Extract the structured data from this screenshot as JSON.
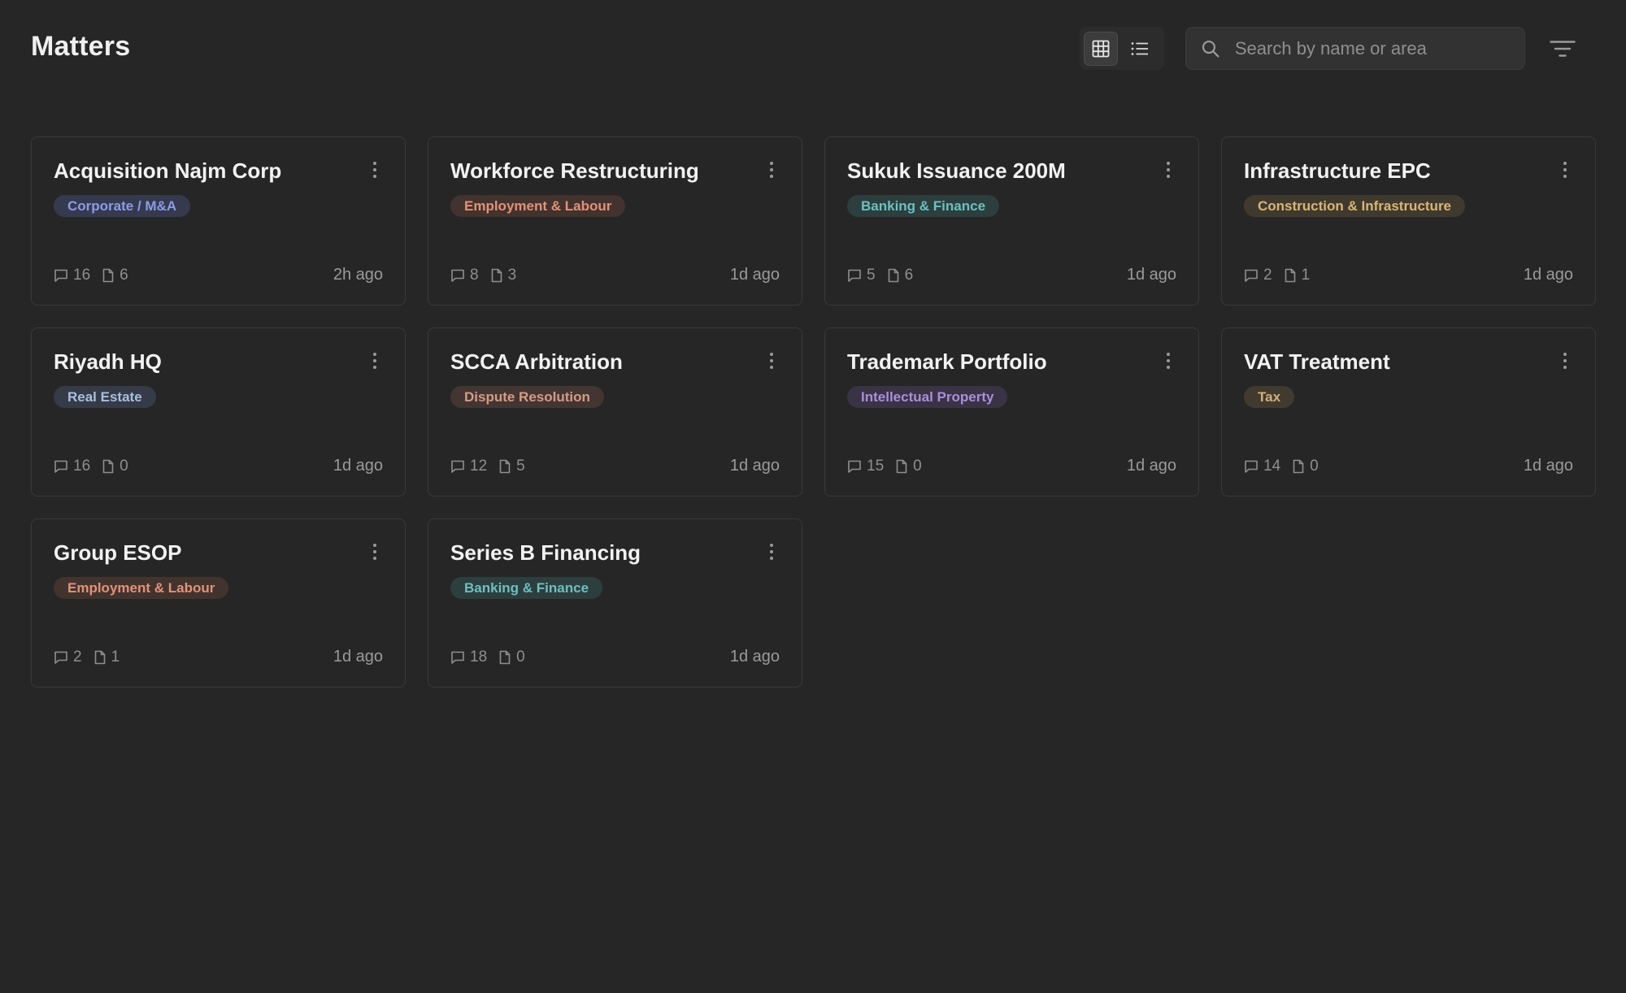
{
  "header": {
    "title": "Matters",
    "search_placeholder": "Search by name or area",
    "search_value": "",
    "view_modes": [
      {
        "name": "grid",
        "icon": "grid-icon",
        "active": true
      },
      {
        "name": "list",
        "icon": "list-icon",
        "active": false
      }
    ],
    "filter_icon": "filter-icon"
  },
  "tag_colors": {
    "Corporate / M&A": {
      "fg": "#8e9be6",
      "bg": "#363a4f"
    },
    "Employment & Labour": {
      "fg": "#e0937a",
      "bg": "#43332e"
    },
    "Banking & Finance": {
      "fg": "#6fbfbf",
      "bg": "#2d3e3e"
    },
    "Construction & Infrastructure": {
      "fg": "#d8b57a",
      "bg": "#403a2e"
    },
    "Real Estate": {
      "fg": "#a9bfe0",
      "bg": "#353b47"
    },
    "Dispute Resolution": {
      "fg": "#d49b86",
      "bg": "#433632"
    },
    "Intellectual Property": {
      "fg": "#a98fd8",
      "bg": "#3a3346"
    },
    "Tax": {
      "fg": "#d2b07a",
      "bg": "#403a2f"
    }
  },
  "matters": [
    {
      "title": "Acquisition Najm Corp",
      "area": "Corporate / M&A",
      "comments": "16",
      "documents": "6",
      "updated": "2h ago"
    },
    {
      "title": "Workforce Restructuring",
      "area": "Employment & Labour",
      "comments": "8",
      "documents": "3",
      "updated": "1d ago"
    },
    {
      "title": "Sukuk Issuance 200M",
      "area": "Banking & Finance",
      "comments": "5",
      "documents": "6",
      "updated": "1d ago"
    },
    {
      "title": "Infrastructure EPC",
      "area": "Construction & Infrastructure",
      "comments": "2",
      "documents": "1",
      "updated": "1d ago"
    },
    {
      "title": "Riyadh HQ",
      "area": "Real Estate",
      "comments": "16",
      "documents": "0",
      "updated": "1d ago"
    },
    {
      "title": "SCCA Arbitration",
      "area": "Dispute Resolution",
      "comments": "12",
      "documents": "5",
      "updated": "1d ago"
    },
    {
      "title": "Trademark Portfolio",
      "area": "Intellectual Property",
      "comments": "15",
      "documents": "0",
      "updated": "1d ago"
    },
    {
      "title": "VAT Treatment",
      "area": "Tax",
      "comments": "14",
      "documents": "0",
      "updated": "1d ago"
    },
    {
      "title": "Group ESOP",
      "area": "Employment & Labour",
      "comments": "2",
      "documents": "1",
      "updated": "1d ago"
    },
    {
      "title": "Series B Financing",
      "area": "Banking & Finance",
      "comments": "18",
      "documents": "0",
      "updated": "1d ago"
    }
  ]
}
